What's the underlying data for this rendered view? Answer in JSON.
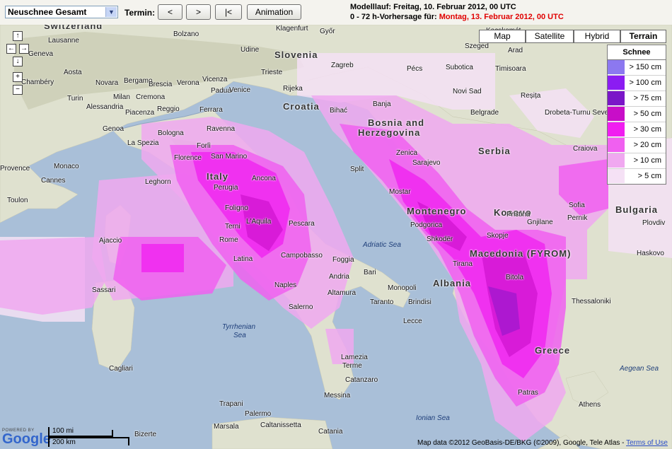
{
  "toolbar": {
    "product_select": "Neuschnee Gesamt",
    "termin_label": "Termin:",
    "btn_prev": "<",
    "btn_next": ">",
    "btn_first": "|<",
    "btn_animation": "Animation"
  },
  "run_info": {
    "modelllauf": "Modelllauf: Freitag, 10. Februar 2012, 00 UTC",
    "forecast_prefix": "0 - 72 h-Vorhersage für: ",
    "forecast_date": "Montag, 13. Februar 2012, 00 UTC"
  },
  "map_types": [
    "Map",
    "Satellite",
    "Hybrid",
    "Terrain"
  ],
  "active_map_type": "Terrain",
  "legend": {
    "title": "Schnee",
    "items": [
      {
        "label": "> 150 cm",
        "color": "#8c78f0"
      },
      {
        "label": "> 100 cm",
        "color": "#8b1cf2"
      },
      {
        "label": "> 75 cm",
        "color": "#7a16c8"
      },
      {
        "label": "> 50 cm",
        "color": "#c80ec8"
      },
      {
        "label": "> 30 cm",
        "color": "#f01ef0"
      },
      {
        "label": "> 20 cm",
        "color": "#f060f0"
      },
      {
        "label": "> 10 cm",
        "color": "#f0a8f0"
      },
      {
        "label": "> 5 cm",
        "color": "#f5e1f5"
      }
    ]
  },
  "nav": {
    "up": "↑",
    "left": "←",
    "right": "→",
    "down": "↓",
    "zoom_in": "+",
    "zoom_out": "−"
  },
  "labels": {
    "countries": {
      "switzerland": "Switzerland",
      "slovenia": "Slovenia",
      "croatia": "Croatia",
      "bosnia": "Bosnia and",
      "herzegovina": "Herzegovina",
      "serbia": "Serbia",
      "italy": "Italy",
      "montenegro": "Montenegro",
      "kosovo": "Kosovo",
      "macedonia": "Macedonia (FYROM)",
      "albania": "Albania",
      "bulgaria": "Bulgaria",
      "greece": "Greece"
    },
    "seas": {
      "adriatic": "Adriatic Sea",
      "tyrrhenian1": "Tyrrhenian",
      "tyrrhenian2": "Sea",
      "ionian": "Ionian Sea",
      "aegean": "Aegean Sea"
    },
    "cities": {
      "lausanne": "Lausanne",
      "geneva": "Geneva",
      "chambery": "Chambéry",
      "aosta": "Aosta",
      "turin": "Turin",
      "novara": "Novara",
      "milan": "Milan",
      "cremona": "Cremona",
      "bergamo": "Bergamo",
      "brescia": "Brescia",
      "verona": "Verona",
      "vicenza": "Vicenza",
      "padua": "Padua",
      "venice": "Venice",
      "trieste": "Trieste",
      "rijeka": "Rijeka",
      "klagenfurt": "Klagenfurt",
      "bolzano": "Bolzano",
      "udine": "Udine",
      "alessandria": "Alessandria",
      "piacenza": "Piacenza",
      "reggio": "Reggio",
      "ferrara": "Ferrara",
      "genoa": "Genoa",
      "la_spezia": "La Spezia",
      "bologna": "Bologna",
      "ravenna": "Ravenna",
      "forli": "Forlì",
      "san_marino": "San Marino",
      "florence": "Florence",
      "leghorn": "Leghorn",
      "monaco": "Monaco",
      "cannes": "Cannes",
      "provence": "Provence",
      "toulon": "Toulon",
      "perugia": "Perugia",
      "ancona": "Ancona",
      "foligno": "Foligno",
      "terni": "Terni",
      "laquila": "L'Aquila",
      "pescara": "Pescara",
      "rome": "Rome",
      "latina": "Latina",
      "campobasso": "Campobasso",
      "naples": "Naples",
      "salerno": "Salerno",
      "foggia": "Foggia",
      "andria": "Andria",
      "bari": "Bari",
      "altamura": "Altamura",
      "monopoli": "Monopoli",
      "taranto": "Taranto",
      "brindisi": "Brindisi",
      "lecce": "Lecce",
      "ajaccio": "Ajaccio",
      "sassari": "Sassari",
      "cagliari": "Cagliari",
      "lamezia": "Lamezia",
      "terme": "Terme",
      "catanzaro": "Catanzaro",
      "trapani": "Trapani",
      "palermo": "Palermo",
      "marsala": "Marsala",
      "caltanissetta": "Caltanissetta",
      "catania": "Catania",
      "messina": "Messina",
      "bizerte": "Bizerte",
      "zagreb": "Zagreb",
      "bihac": "Bihać",
      "split": "Split",
      "zenica": "Zenica",
      "sarajevo": "Sarajevo",
      "mostar": "Mostar",
      "podgorica": "Podgorica",
      "shkoder": "Shkodër",
      "tirana": "Tirana",
      "bitola": "Bitola",
      "skopje": "Skopje",
      "gnjilane": "Gnjilane",
      "pristina": "Pristina",
      "belgrade": "Belgrade",
      "novi_sad": "Novi Sad",
      "subotica": "Subotica",
      "pecs": "Pécs",
      "szeged": "Szeged",
      "arad": "Arad",
      "timisoara": "Timisoara",
      "resita": "Reșița",
      "drobeta": "Drobeta-Turnu Severin",
      "craiova": "Craiova",
      "sofia": "Sofia",
      "pernik": "Pernik",
      "plovdiv": "Plovdiv",
      "haskovo": "Haskovo",
      "thessaloniki": "Thessaloniki",
      "athens": "Athens",
      "patras": "Patras",
      "kecskemet": "Kecskemét",
      "gyor": "Győr",
      "banja": "Banja"
    }
  },
  "attribution": {
    "powered_by": "POWERED BY",
    "google": "Google",
    "copyright": "Map data ©2012 GeoBasis-DE/BKG (©2009), Google, Tele Atlas - ",
    "terms": "Terms of Use"
  },
  "scale": {
    "mi": "100 mi",
    "km": "200 km"
  }
}
